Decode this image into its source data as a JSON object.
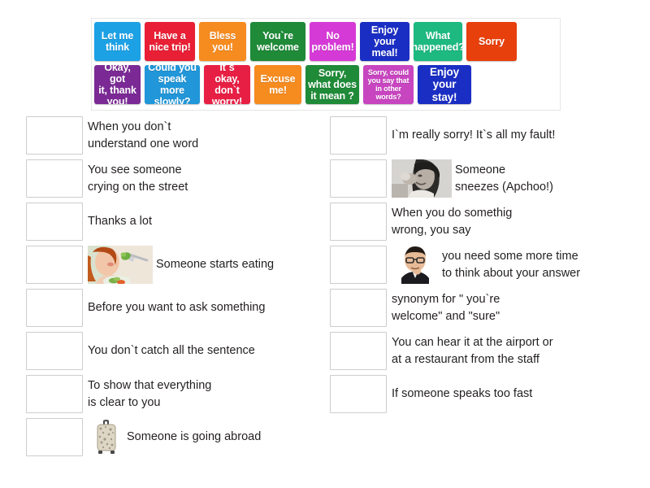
{
  "activity": {
    "type": "match-up-drag-and-drop",
    "tile_bank": {
      "rows": [
        [
          {
            "label": "Let me\nthink",
            "color": "#1da1e5"
          },
          {
            "label": "Have a\nnice trip!",
            "color": "#e81f35"
          },
          {
            "label": "Bless\nyou!",
            "color": "#f68b1f"
          },
          {
            "label": "You`re\nwelcome",
            "color": "#1f8a38"
          },
          {
            "label": "No\nproblem!",
            "color": "#d63ad6"
          },
          {
            "label": "Enjoy your\nmeal!",
            "color": "#1b2ec4"
          },
          {
            "label": "What\nhappened?",
            "color": "#1db981"
          },
          {
            "label": "Sorry",
            "color": "#e8400c"
          }
        ],
        [
          {
            "label": "Okay, got\nit, thank\nyou!",
            "color": "#7b2a95"
          },
          {
            "label": "Could you\nspeak more\nslowly?",
            "color": "#2196d8"
          },
          {
            "label": "It`s okay,\ndon`t\nworry!",
            "color": "#e81f44"
          },
          {
            "label": "Excuse\nme!",
            "color": "#f68b1f"
          },
          {
            "label": "Sorry,\nwhat does\nit mean ?",
            "color": "#1f8a38"
          },
          {
            "label": "Sorry, could\nyou say that\nin other\nwords?",
            "color": "#c845c0"
          },
          {
            "label": "Enjoy\nyour stay!",
            "color": "#1b2ec4"
          }
        ]
      ]
    },
    "left_column": [
      {
        "text": "When you don`t\nunderstand one word",
        "image": null
      },
      {
        "text": "You see someone\ncrying on the street",
        "image": null
      },
      {
        "text": "Thanks a lot",
        "image": null
      },
      {
        "text": "Someone starts eating",
        "image": "woman-eating-salad-photo"
      },
      {
        "text": "Before you want to ask something",
        "image": null
      },
      {
        "text": "You don`t catch all the sentence",
        "image": null
      },
      {
        "text": "To show that everything\nis clear to you",
        "image": null
      },
      {
        "text": "Someone is going abroad",
        "image": "suitcase-photo"
      }
    ],
    "right_column": [
      {
        "text": "I`m really sorry! It`s all my fault!",
        "image": null
      },
      {
        "text": "Someone\nsneezes (Apchoo!)",
        "image": "woman-sneezing-photo"
      },
      {
        "text": "When you do somethig\nwrong, you say",
        "image": null
      },
      {
        "text": "you need some more time\nto think about your answer",
        "image": "man-thinking-photo"
      },
      {
        "text": "synonym for \" you`re\nwelcome\" and \"sure\"",
        "image": null
      },
      {
        "text": "You can hear it at the airport or\nat a restaurant from the staff",
        "image": null
      },
      {
        "text": "If someone speaks too fast",
        "image": null
      }
    ]
  },
  "theme": {
    "page_background": "#ffffff",
    "text_color": "#231f20",
    "dropzone_border": "#cdcdcd",
    "bank_border": "#e6e6e6"
  }
}
